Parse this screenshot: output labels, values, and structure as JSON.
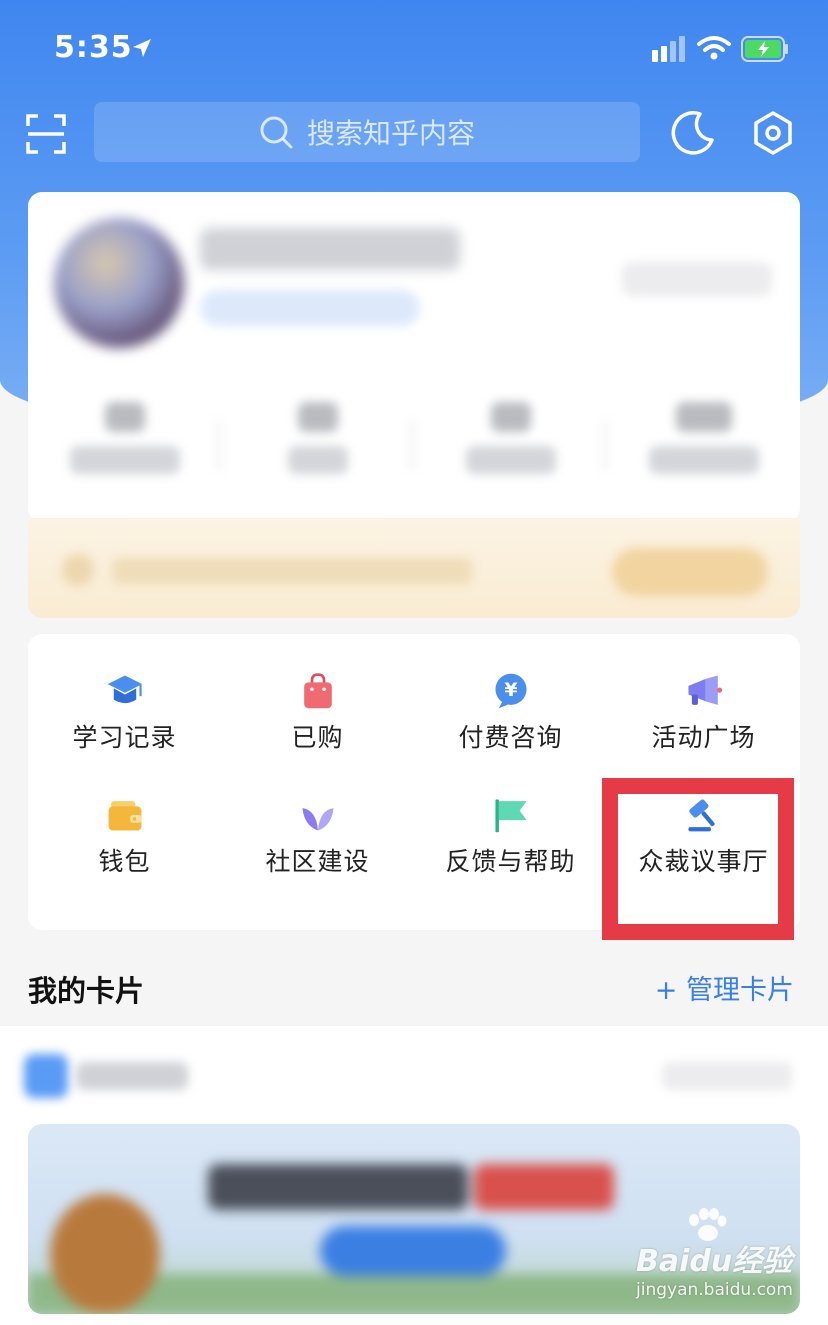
{
  "status_bar": {
    "time": "5:35",
    "icons": [
      "location-arrow-icon",
      "cellular-signal-icon",
      "wifi-icon",
      "battery-charging-icon"
    ],
    "battery_color": "#4cd964"
  },
  "top_bar": {
    "search_placeholder": "搜索知乎内容",
    "icons": [
      "scan-icon",
      "search-icon",
      "moon-icon",
      "settings-hexagon-icon"
    ]
  },
  "profile": {
    "note": ""
  },
  "tools": [
    {
      "label": "学习记录",
      "icon": "graduation-cap-icon",
      "color": "#4a8fee"
    },
    {
      "label": "已购",
      "icon": "shopping-bag-icon",
      "color": "#f06a72"
    },
    {
      "label": "付费咨询",
      "icon": "yuan-chat-icon",
      "color": "#4a8fee"
    },
    {
      "label": "活动广场",
      "icon": "megaphone-icon",
      "color": "#7b7df0"
    },
    {
      "label": "钱包",
      "icon": "wallet-icon",
      "color": "#f4b73c"
    },
    {
      "label": "社区建设",
      "icon": "sprout-icon",
      "color": "#8b7cf0"
    },
    {
      "label": "反馈与帮助",
      "icon": "flag-icon",
      "color": "#3cc9a0"
    },
    {
      "label": "众裁议事厅",
      "icon": "gavel-icon",
      "color": "#4a8fee"
    }
  ],
  "cards_section": {
    "title": "我的卡片",
    "manage_label": "+ 管理卡片"
  },
  "watermark": {
    "logo": "Baidu经验",
    "url": "jingyan.baidu.com"
  },
  "colors": {
    "brand_blue": "#3f86f0",
    "highlight_red": "#e43b46",
    "link_blue": "#3a7fe6"
  }
}
